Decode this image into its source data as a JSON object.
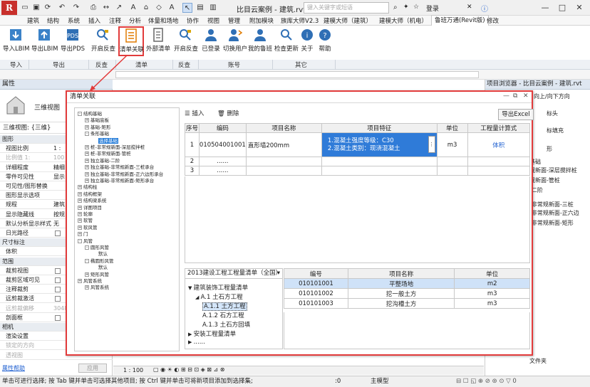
{
  "titlebar": {
    "logo": "R",
    "doc_title": "比目云案例 - 建筑.rvt ...",
    "search_placeholder": "键入关键字或短语",
    "user": "登录",
    "window_controls": [
      "—",
      "□",
      "✕"
    ]
  },
  "menu": {
    "items": [
      "建筑",
      "结构",
      "系统",
      "插入",
      "注释",
      "分析",
      "体量和场地",
      "协作",
      "视图",
      "管理",
      "附加模块",
      "族库大师V2.3",
      "建模大师（建筑）",
      "建模大师（机电）",
      "鲁班万通(Revit版)",
      "修改"
    ],
    "active": "鲁班万通(Revit版)"
  },
  "ribbon": {
    "buttons": [
      {
        "label": "导入LBIM",
        "icon": "import-lbim-icon"
      },
      {
        "label": "导出LBIM",
        "icon": "export-lbim-icon"
      },
      {
        "label": "导出PDS",
        "icon": "export-pds-icon"
      },
      {
        "label": "开启反查",
        "icon": "reverse-lookup-icon"
      },
      {
        "label": "清单关联",
        "icon": "bill-association-icon"
      },
      {
        "label": "外部清单",
        "icon": "external-bill-icon"
      },
      {
        "label": "开启反查",
        "icon": "reverse-lookup-icon"
      },
      {
        "label": "已登录",
        "icon": "user-icon"
      },
      {
        "label": "切换用户",
        "icon": "switch-user-icon"
      },
      {
        "label": "我的鲁班",
        "icon": "my-luban-icon"
      },
      {
        "label": "检查更新",
        "icon": "check-update-icon"
      },
      {
        "label": "关于",
        "icon": "info-icon"
      },
      {
        "label": "帮助",
        "icon": "help-icon"
      }
    ],
    "groups": [
      "导入",
      "导出",
      "反查",
      "清单",
      "反查",
      "账号",
      "其它"
    ]
  },
  "properties": {
    "title": "属性",
    "view_type": "三维视图",
    "selector": "三维视图: {三维}",
    "rows": [
      {
        "k": "图形",
        "type": "sec"
      },
      {
        "k": "视图比例",
        "v": "1 :"
      },
      {
        "k": "比例值 1:",
        "v": "100",
        "type": "grey"
      },
      {
        "k": "详细程度",
        "v": "精细"
      },
      {
        "k": "零件可见性",
        "v": "显示"
      },
      {
        "k": "可见性/图形替换",
        "v": ""
      },
      {
        "k": "图形显示选项",
        "v": ""
      },
      {
        "k": "规程",
        "v": "建筑"
      },
      {
        "k": "显示隐藏线",
        "v": "按规"
      },
      {
        "k": "默认分析显示样式",
        "v": "无"
      },
      {
        "k": "日光路径",
        "v": "",
        "chk": true
      },
      {
        "k": "尺寸标注",
        "type": "sec"
      },
      {
        "k": "体积",
        "v": ""
      },
      {
        "k": "范围",
        "type": "sec"
      },
      {
        "k": "裁剪视图",
        "v": "",
        "chk": true
      },
      {
        "k": "裁剪区域可见",
        "v": "",
        "chk": true
      },
      {
        "k": "注释裁剪",
        "v": "",
        "chk": true
      },
      {
        "k": "远剪裁激活",
        "v": "",
        "chk": true
      },
      {
        "k": "远剪裁偏移",
        "v": "3048",
        "type": "grey"
      },
      {
        "k": "剖面框",
        "v": "",
        "chk": true
      },
      {
        "k": "相机",
        "type": "sec"
      },
      {
        "k": "渲染设置",
        "v": ""
      },
      {
        "k": "锁定的方向",
        "v": "",
        "type": "grey"
      },
      {
        "k": "透视图",
        "v": "",
        "type": "grey"
      }
    ],
    "help_link": "属性帮助",
    "apply": "应用"
  },
  "project_browser": {
    "title": "项目浏览器 - 比目云案例 - 建筑.rvt",
    "partial_items": [
      "向上/向下方向",
      "标头",
      "标填充",
      "形",
      "基础",
      "观新面-深层搅拌桩",
      "观新面-管桩",
      "-二阶",
      "-非常规新面-三桩",
      "-非常规新面-正六边",
      "-非常规新面-矩形",
      "文件夹"
    ]
  },
  "statusbar": {
    "text": "单击可进行选择; 按 Tab 键并单击可选择其他项目; 按 Ctrl 键并单击可将新项目添加到选择集;",
    "model": "主模型",
    "scale": "1 : 100",
    "zero": ":0"
  },
  "dialog": {
    "title": "清单关联",
    "toolbar": {
      "insert": "插入",
      "delete": "删除",
      "export": "导出Excel"
    },
    "tree": [
      {
        "t": "结构基础",
        "lv": 0,
        "pm": "-"
      },
      {
        "t": "基础底板",
        "lv": 1,
        "pm": "+"
      },
      {
        "t": "基础-矩形",
        "lv": 1,
        "pm": "+"
      },
      {
        "t": "条形基础",
        "lv": 1,
        "pm": "-"
      },
      {
        "t": "选择基础",
        "lv": 2,
        "sel": true
      },
      {
        "t": "桩-非常规新面-深层搅拌桩",
        "lv": 1,
        "pm": "+"
      },
      {
        "t": "桩-非常规新面-管桩",
        "lv": 1,
        "pm": "+"
      },
      {
        "t": "独立基础-二阶",
        "lv": 1,
        "pm": "+"
      },
      {
        "t": "独立基础-非常规新面-三桩承台",
        "lv": 1,
        "pm": "+"
      },
      {
        "t": "独立基础-非常规新面-正六边形承台",
        "lv": 1,
        "pm": "+"
      },
      {
        "t": "独立基础-非常规新面-矩形承台",
        "lv": 1,
        "pm": "+"
      },
      {
        "t": "结构柱",
        "lv": 0,
        "pm": "+"
      },
      {
        "t": "结构框架",
        "lv": 0,
        "pm": "+"
      },
      {
        "t": "结构梁系统",
        "lv": 0,
        "pm": "+"
      },
      {
        "t": "详图项目",
        "lv": 0,
        "pm": "+"
      },
      {
        "t": "轮廓",
        "lv": 0,
        "pm": "+"
      },
      {
        "t": "软管",
        "lv": 0,
        "pm": "+"
      },
      {
        "t": "软风管",
        "lv": 0,
        "pm": "+"
      },
      {
        "t": "门",
        "lv": 0,
        "pm": "+"
      },
      {
        "t": "风管",
        "lv": 0,
        "pm": "-"
      },
      {
        "t": "圆形风管",
        "lv": 1,
        "pm": "-"
      },
      {
        "t": "默认",
        "lv": 2
      },
      {
        "t": "椭圆形风管",
        "lv": 1,
        "pm": "-"
      },
      {
        "t": "默认",
        "lv": 2
      },
      {
        "t": "矩形风管",
        "lv": 1,
        "pm": "+"
      },
      {
        "t": "风管系统",
        "lv": 0,
        "pm": "+"
      },
      {
        "t": "风管系统",
        "lv": 1,
        "pm": "+"
      }
    ],
    "main_table": {
      "headers": [
        "序号",
        "编码",
        "项目名称",
        "项目特征",
        "单位",
        "工程量计算式"
      ],
      "rows": [
        {
          "no": "1",
          "code": "010504001001",
          "name": "直形墙200mm",
          "feat1": "1.混凝土强度等级：C30",
          "feat2": "2.混凝土类别：现浇混凝土",
          "unit": "m3",
          "formula": "体积"
        },
        {
          "no": "2",
          "code": "......",
          "name": "",
          "feat1": "",
          "feat2": "",
          "unit": "",
          "formula": ""
        },
        {
          "no": "3",
          "code": "......",
          "name": "",
          "feat1": "",
          "feat2": "",
          "unit": "",
          "formula": ""
        }
      ]
    },
    "library": {
      "selected": "2013建设工程工程量清单（全国）",
      "tree": [
        {
          "t": "建筑装饰工程量清单",
          "lv": 0,
          "arrow": "▼"
        },
        {
          "t": "A.1 土石方工程",
          "lv": 1,
          "arrow": "◢"
        },
        {
          "t": "A.1.1 土方工程",
          "lv": 2,
          "sel": true
        },
        {
          "t": "A.1.2 石方工程",
          "lv": 2
        },
        {
          "t": "A.1.3 土石方回填",
          "lv": 2
        },
        {
          "t": "安装工程量清单",
          "lv": 0,
          "arrow": "▶"
        },
        {
          "t": "......",
          "lv": 0,
          "arrow": "▶"
        }
      ]
    },
    "lower_table": {
      "headers": [
        "编号",
        "项目名称",
        "单位"
      ],
      "rows": [
        {
          "code": "010101001",
          "name": "平整场地",
          "unit": "m2"
        },
        {
          "code": "010101002",
          "name": "挖一般土方",
          "unit": "m3"
        },
        {
          "code": "010101003",
          "name": "挖沟槽土方",
          "unit": "m3"
        }
      ]
    }
  },
  "colors": {
    "highlight_border": "#e23b3b",
    "selection": "#2f7bd8",
    "link": "#1e5fd0"
  }
}
